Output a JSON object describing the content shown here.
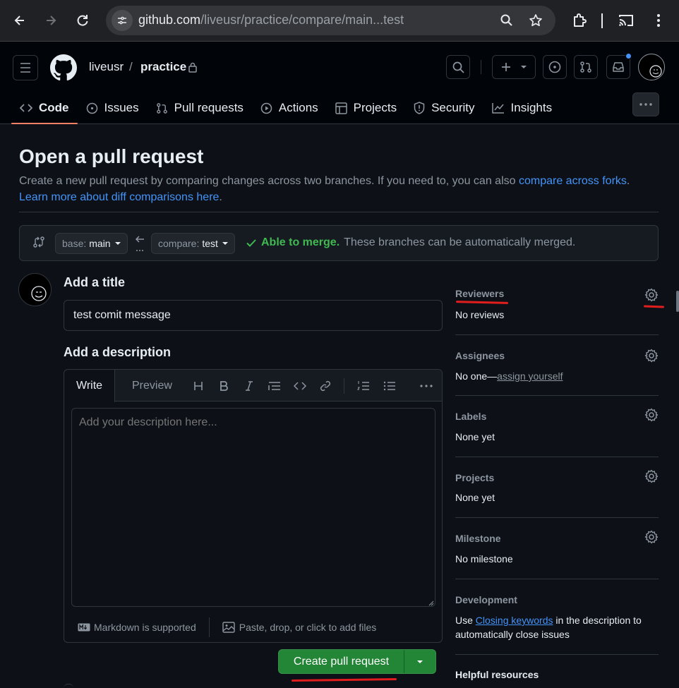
{
  "browser": {
    "url_host": "github.com",
    "url_path": "/liveusr/practice/compare/main...test"
  },
  "header": {
    "owner": "liveusr",
    "separator": "/",
    "repo": "practice",
    "tabs": [
      {
        "label": "Code",
        "icon": "code-icon"
      },
      {
        "label": "Issues",
        "icon": "issue-icon"
      },
      {
        "label": "Pull requests",
        "icon": "pull-request-icon"
      },
      {
        "label": "Actions",
        "icon": "play-icon"
      },
      {
        "label": "Projects",
        "icon": "table-icon"
      },
      {
        "label": "Security",
        "icon": "shield-icon"
      },
      {
        "label": "Insights",
        "icon": "graph-icon"
      }
    ]
  },
  "main": {
    "title": "Open a pull request",
    "subtitle_pre": "Create a new pull request by comparing changes across two branches. If you need to, you can also ",
    "subtitle_link1": "compare across forks",
    "subtitle_mid": ".",
    "subtitle_link2": "Learn more about diff comparisons here",
    "subtitle_end": ".",
    "base_label": "base:",
    "base_value": "main",
    "compare_label": "compare:",
    "compare_value": "test",
    "merge_ok": "Able to merge.",
    "merge_text": "These branches can be automatically merged.",
    "add_title_label": "Add a title",
    "title_value": "test comit message",
    "add_description_label": "Add a description",
    "tab_write": "Write",
    "tab_preview": "Preview",
    "description_placeholder": "Add your description here...",
    "markdown_note": "Markdown is supported",
    "attach_note": "Paste, drop, or click to add files",
    "create_button": "Create pull request"
  },
  "sidebar": {
    "reviewers": {
      "title": "Reviewers",
      "value": "No reviews"
    },
    "assignees": {
      "title": "Assignees",
      "value": "No one—",
      "link": "assign yourself"
    },
    "labels": {
      "title": "Labels",
      "value": "None yet"
    },
    "projects": {
      "title": "Projects",
      "value": "None yet"
    },
    "milestone": {
      "title": "Milestone",
      "value": "No milestone"
    },
    "development": {
      "title": "Development",
      "pre": "Use ",
      "link": "Closing keywords",
      "post": " in the description to",
      "line2": "automatically close issues"
    },
    "helpful": {
      "title": "Helpful resources"
    }
  },
  "colors": {
    "accent_link": "#4493f8",
    "success": "#3fb950",
    "primary_button": "#238636",
    "active_tab_underline": "#f78166",
    "annotation_red": "#e11d1d"
  }
}
